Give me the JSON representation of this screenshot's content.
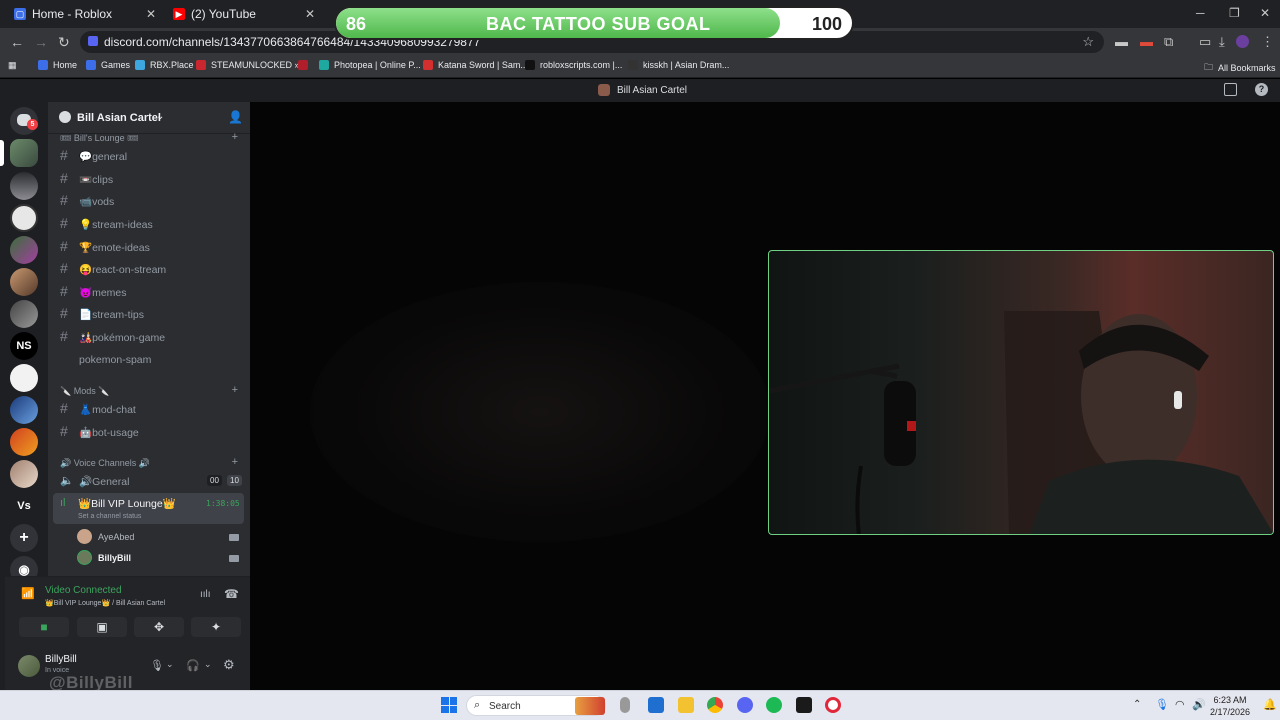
{
  "browser": {
    "tabs": [
      {
        "label": "Home - Roblox",
        "favicon": "roblox-icon"
      },
      {
        "label": "(2) YouTube",
        "favicon": "youtube-icon"
      }
    ],
    "url": "discord.com/channels/1343770663864766484/1433409680993279877",
    "bookmarks": [
      "Home",
      "Games",
      "RBX.Place",
      "STEAMUNLOCKED »...",
      "Photopea | Online P...",
      "Katana Sword | Sam...",
      "robloxscripts.com |...",
      "kisskh | Asian Dram..."
    ],
    "all_bookmarks": "All Bookmarks"
  },
  "goal": {
    "current": "86",
    "label": "BAC TATTOO SUB GOAL",
    "target": "100",
    "progress": 0.86
  },
  "discord": {
    "window_title": "Bill Asian Cartel",
    "server_name": "Bill Asian Cartel",
    "categories": {
      "lounge": "🎟 Bill's Lounge 🎟",
      "mods": "🔪 Mods 🔪",
      "voice": "🔊 Voice Channels 🔊"
    },
    "text_channels": [
      "💬general",
      "📼clips",
      "📹vods",
      "💡stream-ideas",
      "🏆emote-ideas",
      "😝react-on-stream",
      "😈memes",
      "📄stream-tips",
      "🎎pokémon-game",
      "pokemon-spam"
    ],
    "mod_channels": [
      "👗mod-chat",
      "🤖bot-usage"
    ],
    "voice_general": {
      "name": "🔊General",
      "count_a": "00",
      "count_b": "10"
    },
    "vip": {
      "name": "👑Bill VIP Lounge👑",
      "timer": "1:38:05",
      "status": "Set a channel status"
    },
    "voice_users": [
      "AyeAbed",
      "BillyBill"
    ],
    "voice_panel": {
      "status": "Video Connected",
      "location": "👑Bill VIP Lounge👑 / Bill Asian Cartel"
    },
    "user": {
      "name": "BillyBill",
      "status": "In voice"
    },
    "rail_badge": "5",
    "rail_text_servers": [
      "NS",
      "Vs"
    ]
  },
  "watermark": "@BillyBill",
  "taskbar": {
    "search": "Search",
    "time": "6:23 AM",
    "date": "2/17/2026"
  }
}
